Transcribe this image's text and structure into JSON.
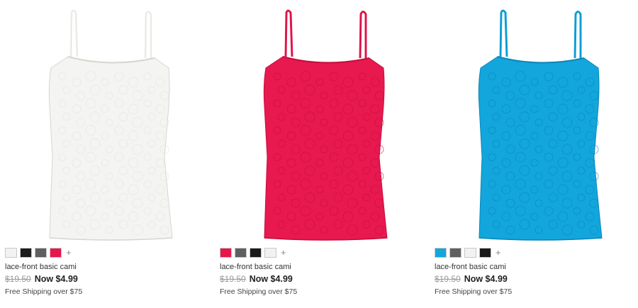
{
  "products": [
    {
      "name": "lace-front basic cami",
      "original_price": "$19.50",
      "sale_price": "Now $4.99",
      "shipping": "Free Shipping over $75",
      "image_color": "#f4f4f2",
      "lace_color": "#e1e1dc",
      "swatches": [
        "#f2f2f2",
        "#1b1b1b",
        "#5f5f5f",
        "#e6174a"
      ],
      "more_label": "+"
    },
    {
      "name": "lace-front basic cami",
      "original_price": "$19.50",
      "sale_price": "Now $4.99",
      "shipping": "Free Shipping over $75",
      "image_color": "#e8194f",
      "lace_color": "#c40d3d",
      "swatches": [
        "#e6174a",
        "#5f5f5f",
        "#1b1b1b",
        "#f2f2f2"
      ],
      "more_label": "+"
    },
    {
      "name": "lace-front basic cami",
      "original_price": "$19.50",
      "sale_price": "Now $4.99",
      "shipping": "Free Shipping over $75",
      "image_color": "#12a6dc",
      "lace_color": "#0a86b8",
      "swatches": [
        "#12a6dc",
        "#5f5f5f",
        "#f2f2f2",
        "#1b1b1b"
      ],
      "more_label": "+"
    }
  ]
}
